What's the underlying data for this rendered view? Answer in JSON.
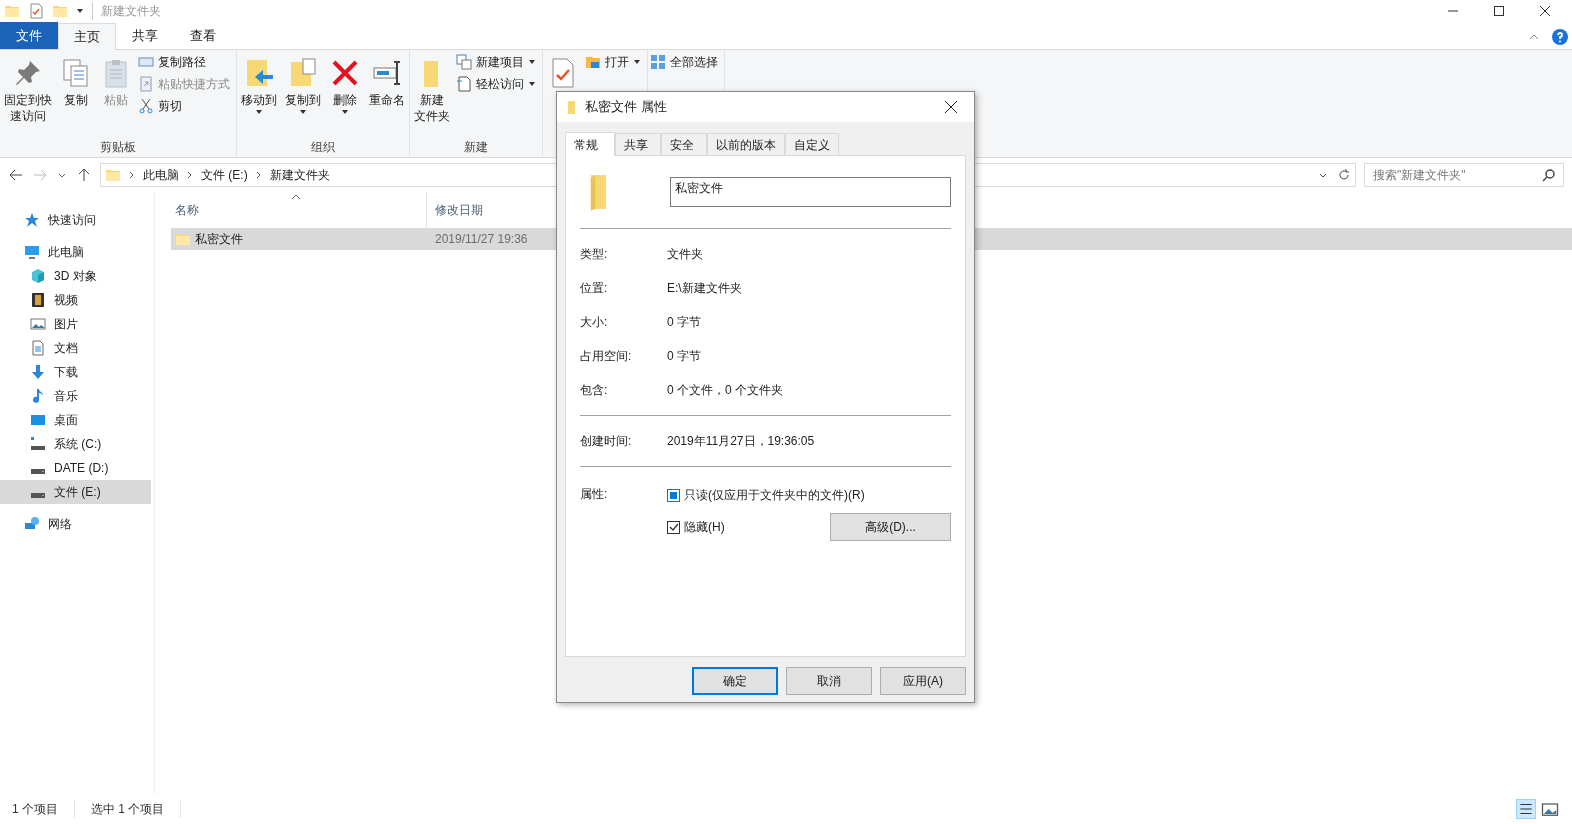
{
  "window": {
    "title": "新建文件夹"
  },
  "ribbon_tabs": [
    {
      "label": "文件",
      "kind": "file",
      "selected": false
    },
    {
      "label": "主页",
      "kind": "tab",
      "selected": true
    },
    {
      "label": "共享",
      "kind": "tab",
      "selected": false
    },
    {
      "label": "查看",
      "kind": "tab",
      "selected": false
    }
  ],
  "ribbon_groups": [
    {
      "label": "剪贴板",
      "items": [
        {
          "kind": "large",
          "lines": [
            "固定到快",
            "速访问"
          ],
          "disabled": false,
          "dropdown": false
        },
        {
          "kind": "large",
          "lines": [
            "复制"
          ],
          "disabled": false,
          "dropdown": false
        },
        {
          "kind": "large",
          "lines": [
            "粘贴"
          ],
          "disabled": true,
          "dropdown": false
        },
        {
          "kind": "small",
          "lines": [
            "复制路径"
          ],
          "disabled": false,
          "dropdown": false
        },
        {
          "kind": "small",
          "lines": [
            "粘贴快捷方式"
          ],
          "disabled": true,
          "dropdown": false
        },
        {
          "kind": "small",
          "lines": [
            "剪切"
          ],
          "disabled": false,
          "dropdown": false
        }
      ]
    },
    {
      "label": "组织",
      "items": [
        {
          "kind": "large",
          "lines": [
            "移动到"
          ],
          "disabled": false,
          "dropdown": true
        },
        {
          "kind": "large",
          "lines": [
            "复制到"
          ],
          "disabled": false,
          "dropdown": true
        },
        {
          "kind": "large",
          "lines": [
            "删除"
          ],
          "disabled": false,
          "dropdown": true
        },
        {
          "kind": "large",
          "lines": [
            "重命名"
          ],
          "disabled": false,
          "dropdown": false
        }
      ]
    },
    {
      "label": "新建",
      "items": [
        {
          "kind": "large",
          "lines": [
            "新建",
            "文件夹"
          ],
          "disabled": false,
          "dropdown": false
        },
        {
          "kind": "small",
          "lines": [
            "新建项目"
          ],
          "disabled": false,
          "dropdown": true
        },
        {
          "kind": "small",
          "lines": [
            "轻松访问"
          ],
          "disabled": false,
          "dropdown": true
        }
      ]
    },
    {
      "items": [
        {
          "kind": "large",
          "disabled": false
        },
        {
          "kind": "small",
          "lines": [
            "打开"
          ],
          "disabled": false,
          "dropdown": true
        }
      ]
    },
    {
      "items": [
        {
          "kind": "small",
          "lines": [
            "全部选择"
          ],
          "disabled": false,
          "dropdown": false
        }
      ]
    }
  ],
  "address": {
    "path": [
      "此电脑",
      "文件 (E:)",
      "新建文件夹"
    ],
    "search_placeholder": "搜索\"新建文件夹\""
  },
  "sidebar": {
    "items": [
      {
        "label": "快速访问",
        "selected": false
      },
      {
        "label": "此电脑",
        "selected": false,
        "children": [
          {
            "label": "3D 对象",
            "selected": false
          },
          {
            "label": "视频",
            "selected": false
          },
          {
            "label": "图片",
            "selected": false
          },
          {
            "label": "文档",
            "selected": false
          },
          {
            "label": "下载",
            "selected": false
          },
          {
            "label": "音乐",
            "selected": false
          },
          {
            "label": "桌面",
            "selected": false
          },
          {
            "label": "系统 (C:)",
            "selected": false
          },
          {
            "label": "DATE (D:)",
            "selected": false
          },
          {
            "label": "文件 (E:)",
            "selected": true
          }
        ]
      },
      {
        "label": "网络",
        "selected": false
      }
    ]
  },
  "file_list": {
    "columns": [
      "名称",
      "修改日期"
    ],
    "rows": [
      {
        "name": "私密文件",
        "date": "2019/11/27 19:36",
        "selected": true
      }
    ]
  },
  "status_bar": [
    "1 个项目",
    "选中 1 个项目"
  ],
  "dialog": {
    "title": "私密文件 属性",
    "tabs": [
      {
        "label": "常规",
        "selected": true
      },
      {
        "label": "共享",
        "selected": false
      },
      {
        "label": "安全",
        "selected": false
      },
      {
        "label": "以前的版本",
        "selected": false
      },
      {
        "label": "自定义",
        "selected": false
      }
    ],
    "name": "私密文件",
    "sections": [
      [
        {
          "label": "类型:",
          "value": "文件夹"
        },
        {
          "label": "位置:",
          "value": "E:\\新建文件夹"
        },
        {
          "label": "大小:",
          "value": "0 字节"
        },
        {
          "label": "占用空间:",
          "value": "0 字节"
        },
        {
          "label": "包含:",
          "value": "0 个文件，0 个文件夹"
        }
      ],
      [
        {
          "label": "创建时间:",
          "value": "2019年11月27日，19:36:05"
        }
      ]
    ],
    "attributes_label": "属性:",
    "attributes": [
      {
        "label": "只读(仅应用于文件夹中的文件)(R)",
        "checked": false,
        "indeterminate": true
      },
      {
        "label": "隐藏(H)",
        "checked": true,
        "indeterminate": false
      }
    ],
    "advanced_button": "高级(D)...",
    "buttons": [
      {
        "label": "确定",
        "default": true
      },
      {
        "label": "取消",
        "default": false
      },
      {
        "label": "应用(A)",
        "default": false
      }
    ]
  }
}
